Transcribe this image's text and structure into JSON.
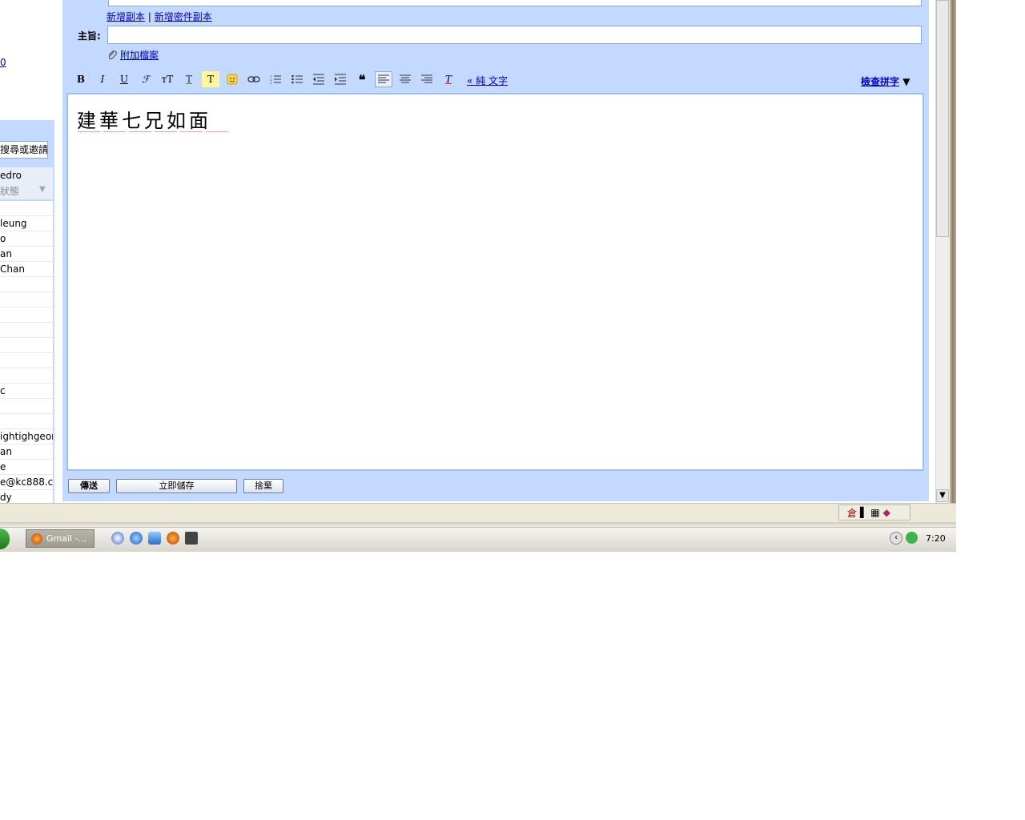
{
  "left_pane": {
    "partial_link": "0",
    "chat_search_text": "搜尋或邀請",
    "self_name": "edro",
    "self_status": "狀態",
    "contacts": [
      "",
      "leung",
      "o",
      "an",
      "Chan",
      "",
      "",
      "",
      "",
      "",
      "",
      "",
      "c",
      "",
      "",
      "ightighgeorge",
      "an",
      "e",
      "e@kc888.c",
      "dy"
    ]
  },
  "compose": {
    "cc_link": "新增副本",
    "separator": "|",
    "bcc_link": "新增密件副本",
    "subject_label": "主旨:",
    "subject_value": "",
    "attach_label": "附加檔案",
    "toolbar": {
      "bold": "B",
      "italic": "I",
      "underline": "U",
      "font": "ℱ",
      "size": "тT",
      "text_color": "T",
      "highlight": "T",
      "blockquote": "❝",
      "remove_format": "T"
    },
    "plain_text_link": "« 純 文字",
    "spell_check": "檢查拼字",
    "spell_arrow": "▼",
    "body_text": "建華七兄如面",
    "buttons": {
      "send": "傳送",
      "save": "立即儲存",
      "discard": "捨棄"
    }
  },
  "ime": {
    "cangjie": "倉"
  },
  "taskbar": {
    "task_label": "Gmail -...",
    "clock": "7:20"
  },
  "colors": {
    "compose_bg": "#c3d9ff",
    "link": "#0000cc",
    "border": "#8aa8d8"
  }
}
